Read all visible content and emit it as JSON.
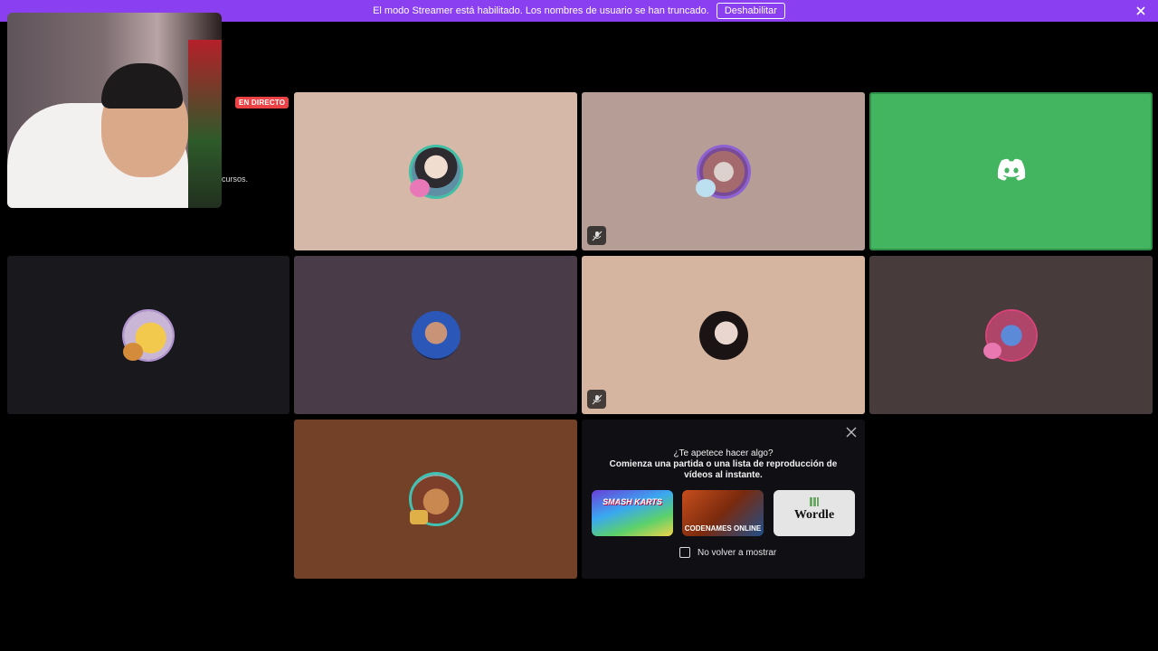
{
  "banner": {
    "text": "El modo Streamer está habilitado. Los nombres de usuario se han truncado.",
    "button": "Deshabilitar",
    "color": "#8a3ff0"
  },
  "stage": {
    "live_badge": "EN DIRECTO",
    "hidden_text": "cursos."
  },
  "tiles": [
    {
      "bg": "#d6b8a8",
      "avatar": "user-avatar-1",
      "muted": false
    },
    {
      "bg": "#b69e97",
      "avatar": "user-avatar-2",
      "muted": true
    },
    {
      "bg": "#43b45f",
      "avatar": "discord-logo-icon",
      "muted": false
    },
    {
      "bg": "#19181d",
      "avatar": "user-avatar-3",
      "muted": false
    },
    {
      "bg": "#493b47",
      "avatar": "user-avatar-4",
      "muted": false
    },
    {
      "bg": "#d6b5a0",
      "avatar": "user-avatar-5",
      "muted": true
    },
    {
      "bg": "#473b3c",
      "avatar": "user-avatar-6",
      "muted": false
    },
    {
      "bg": "#734128",
      "avatar": "user-avatar-7",
      "muted": false
    }
  ],
  "activity_panel": {
    "title": "¿Te apetece hacer algo?",
    "subtitle": "Comienza una partida o una lista de reproducción de vídeos al instante.",
    "games": [
      {
        "name": "SMASH KARTS"
      },
      {
        "name": "CODENAMES ONLINE"
      },
      {
        "name": "Wordle"
      }
    ],
    "checkbox_label": "No volver a mostrar"
  }
}
